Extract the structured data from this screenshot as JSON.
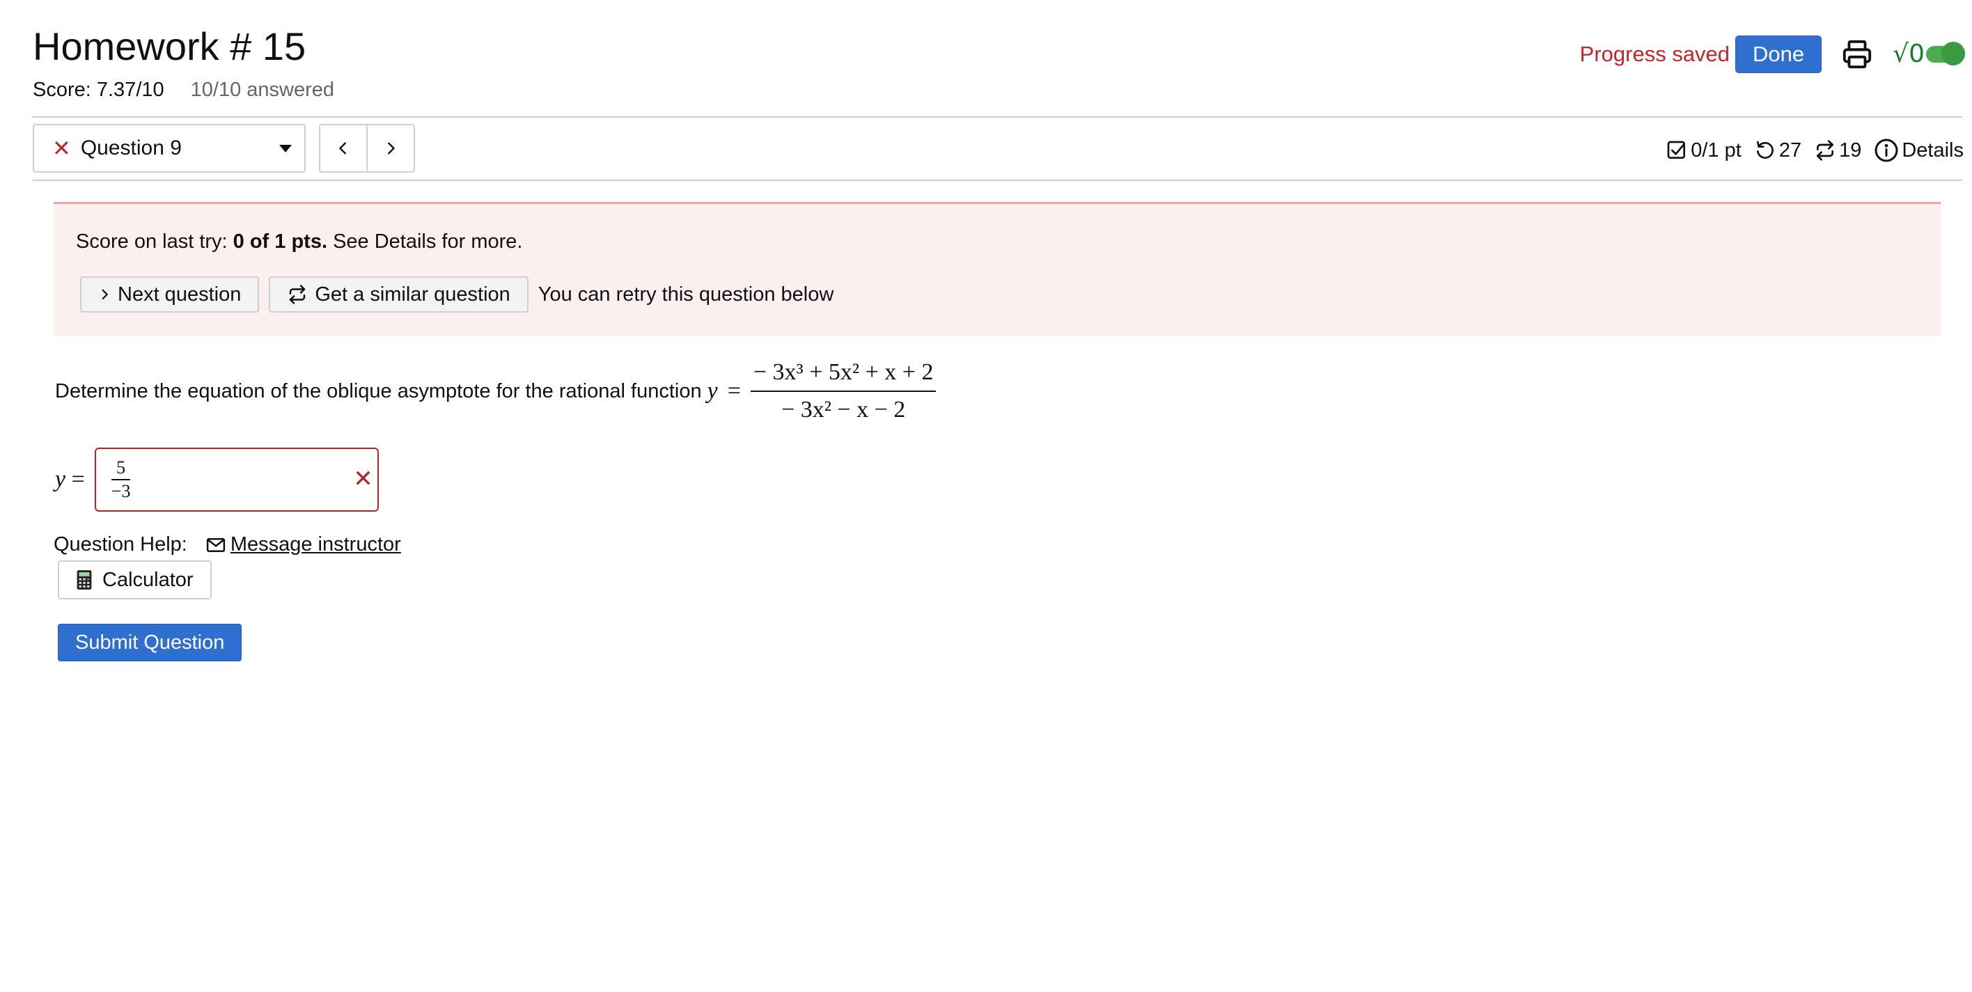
{
  "header": {
    "title": "Homework # 15",
    "score": "Score: 7.37/10",
    "answered": "10/10 answered",
    "progress_status": "Progress saved",
    "done_label": "Done",
    "math_toggle_glyph": "√0"
  },
  "question_nav": {
    "status_icon": "close-icon",
    "selected_question": "Question 9",
    "points": "0/1 pt",
    "retries_left": "27",
    "similar_left": "19",
    "details_label": "Details"
  },
  "feedback": {
    "prefix": "Score on last try: ",
    "score_bold": "0 of 1 pts.",
    "suffix": " See Details for more.",
    "next_question_label": "Next question",
    "similar_question_label": "Get a similar question",
    "retry_text": "You can retry this question below"
  },
  "question": {
    "prompt": "Determine the equation of the oblique asymptote for the rational function",
    "lhs": "y",
    "equals": "=",
    "numerator": "− 3x³ + 5x² + x + 2",
    "denominator": "− 3x² − x − 2"
  },
  "answer": {
    "label": "y",
    "equals": "=",
    "numerator": "5",
    "denominator": "−3",
    "status": "incorrect"
  },
  "help": {
    "label": "Question Help:",
    "message_label": "Message instructor",
    "calculator_label": "Calculator"
  },
  "submit_label": "Submit Question",
  "colors": {
    "primary": "#2e6fd0",
    "error": "#c0262d",
    "banner_bg": "#fcefef",
    "toggle_green": "#4caa4f"
  }
}
